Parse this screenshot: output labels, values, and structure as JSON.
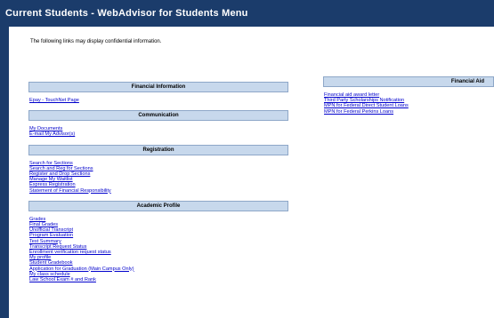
{
  "header": {
    "title": "Current Students - WebAdvisor for Students Menu"
  },
  "notice": "The following links may display confidential information.",
  "left_sections": [
    {
      "title": "Financial Information",
      "links": [
        "Epay - TouchNet Page"
      ]
    },
    {
      "title": "Communication",
      "links": [
        "My Documents",
        "E-mail My Advisor(s)"
      ]
    },
    {
      "title": "Registration",
      "links": [
        "Search for Sections",
        "Search and Reg for Sections",
        "Register and Drop Sections",
        "Manage My Waitlist",
        "Express Registration",
        "Statement of Financial Responsibility"
      ]
    },
    {
      "title": "Academic Profile",
      "links": [
        "Grades",
        "Final Grades",
        "Unofficial Transcript",
        "Program Evaluation",
        "Test Summary",
        "Transcript Request Status",
        "Enrollment verification request status",
        "My profile",
        "Student Gradebook",
        "Application for Graduation (Main Campus Only)",
        "My class schedule",
        "Law School Exam # and Rank"
      ]
    }
  ],
  "right_sections": [
    {
      "title": "Financial Aid",
      "links": [
        "Financial aid award letter",
        "Third Party Scholarships Notification",
        "MPN for Federal Direct Student Loans",
        "MPN for Federal Perkins Loans"
      ]
    }
  ],
  "colors": {
    "header_bg": "#1b3c6b",
    "section_header_bg": "#c7d8ec",
    "link": "#0000cc"
  }
}
